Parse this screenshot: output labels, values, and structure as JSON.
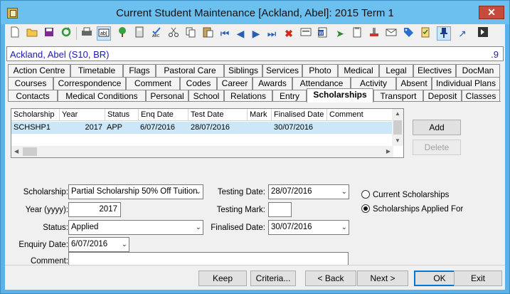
{
  "window": {
    "title": "Current Student Maintenance  [Ackland, Abel]:  2015 Term 1",
    "close_label": "✕"
  },
  "toolbar": {
    "icons": [
      "new-icon",
      "open-icon",
      "save-icon",
      "refresh-icon",
      "print-icon",
      "text-field-icon",
      "tree-icon",
      "calculator-icon",
      "spellcheck-icon",
      "cut-icon",
      "copy-icon",
      "paste-icon",
      "first-record-icon",
      "previous-record-icon",
      "next-record-icon",
      "last-record-icon",
      "delete-icon",
      "id-card-icon",
      "word-icon",
      "send-icon",
      "clipboard-icon",
      "stamp-icon",
      "email-icon",
      "tag-icon",
      "checklist-icon",
      "pin-icon",
      "arrow-icon",
      "exit-icon"
    ]
  },
  "student": {
    "name": "Ackland, Abel (S10, BR)",
    "number": ".9"
  },
  "tabs": {
    "row1": [
      "Action Centre",
      "Timetable",
      "Flags",
      "Pastoral Care",
      "Siblings",
      "Services",
      "Photo",
      "Medical",
      "Legal",
      "Electives",
      "DocMan"
    ],
    "row2": [
      "Courses",
      "Correspondence",
      "Comment",
      "Codes",
      "Career",
      "Awards",
      "Attendance",
      "Activity",
      "Absent",
      "Individual Plans"
    ],
    "row3": [
      "Contacts",
      "Medical Conditions",
      "Personal",
      "School",
      "Relations",
      "Entry",
      "Scholarships",
      "Transport",
      "Deposit",
      "Classes"
    ],
    "selected": "Scholarships"
  },
  "grid": {
    "headers": [
      "Scholarship",
      "Year",
      "Status",
      "Enq Date",
      "Test Date",
      "Mark",
      "Finalised Date",
      "Comment"
    ],
    "rows": [
      {
        "scholarship": "SCHSHP1",
        "year": "2017",
        "status": "APP",
        "enq_date": "6/07/2016",
        "test_date": "28/07/2016",
        "mark": "",
        "finalised_date": "30/07/2016",
        "comment": ""
      }
    ]
  },
  "side_buttons": {
    "add": "Add",
    "delete": "Delete"
  },
  "form": {
    "scholarship_label": "Scholarship:",
    "scholarship_value": "Partial Scholarship 50% Off Tuition",
    "year_label": "Year (yyyy):",
    "year_value": "2017",
    "status_label": "Status:",
    "status_value": "Applied",
    "enquiry_label": "Enquiry Date:",
    "enquiry_value": "6/07/2016",
    "comment_label": "Comment:",
    "comment_value": "",
    "testing_date_label": "Testing Date:",
    "testing_date_value": "28/07/2016",
    "testing_mark_label": "Testing Mark:",
    "testing_mark_value": "",
    "finalised_label": "Finalised Date:",
    "finalised_value": "30/07/2016"
  },
  "filter": {
    "current": "Current Scholarships",
    "applied": "Scholarships Applied For",
    "selected": "applied"
  },
  "buttons": {
    "keep": "Keep",
    "criteria": "Criteria...",
    "back": "< Back",
    "next": "Next >",
    "ok": "OK",
    "exit": "Exit"
  },
  "colors": {
    "titlebar": "#6cc0f0",
    "selection": "#cce8f8",
    "student": "#1a1ab0",
    "close": "#c74b3c"
  }
}
